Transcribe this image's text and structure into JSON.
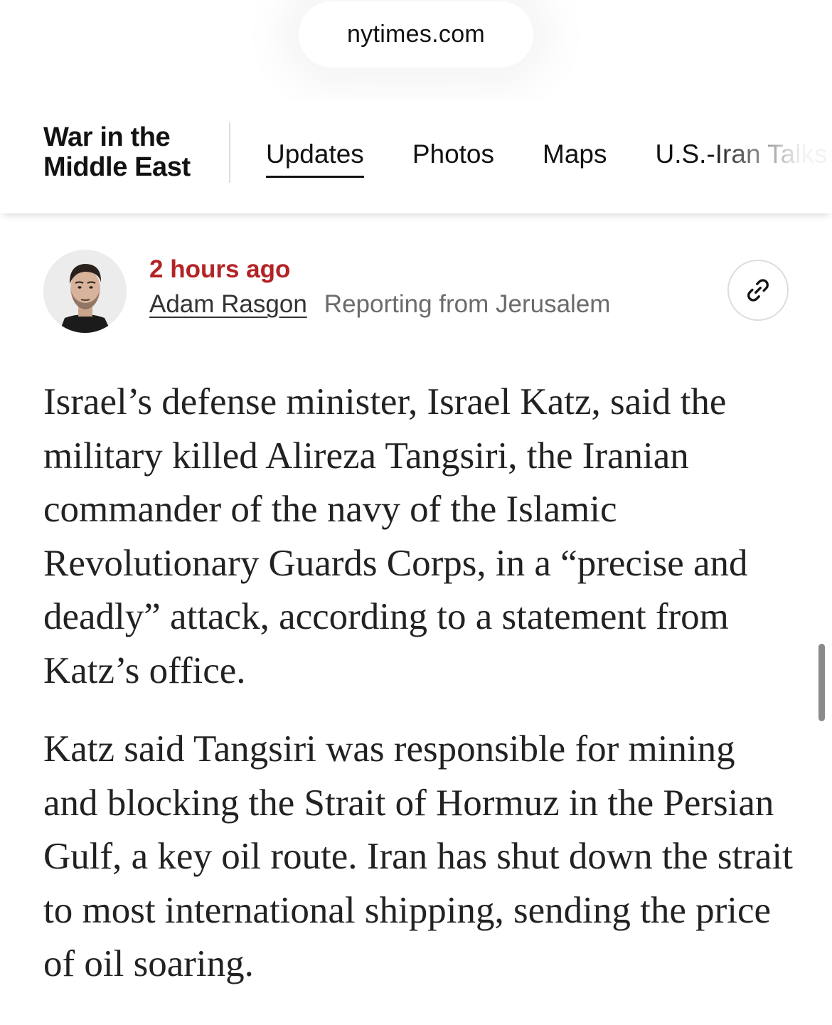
{
  "browser": {
    "url": "nytimes.com"
  },
  "section": {
    "title_line1": "War in the",
    "title_line2": "Middle East",
    "nav": [
      {
        "label": "Updates",
        "active": true
      },
      {
        "label": "Photos",
        "active": false
      },
      {
        "label": "Maps",
        "active": false
      },
      {
        "label": "U.S.-Iran Talks",
        "active": false
      }
    ]
  },
  "post": {
    "timestamp": "2 hours ago",
    "author": "Adam Rasgon",
    "dateline": "Reporting from Jerusalem",
    "link_icon": "link-icon",
    "paragraphs": [
      "Israel’s defense minister, Israel Katz, said the military killed Alireza Tangsiri, the Iranian commander of the navy of the Islamic Revolutionary Guards Corps, in a “precise and deadly” attack, according to a statement from Katz’s office.",
      "Katz said Tangsiri was responsible for mining and blocking the Strait of Hormuz in the Persian Gulf, a key oil route. Iran has shut down the strait to most international shipping, sending the price of oil soaring."
    ]
  },
  "colors": {
    "timestamp_red": "#b32325",
    "text": "#121212",
    "muted": "#6b6b6b"
  }
}
